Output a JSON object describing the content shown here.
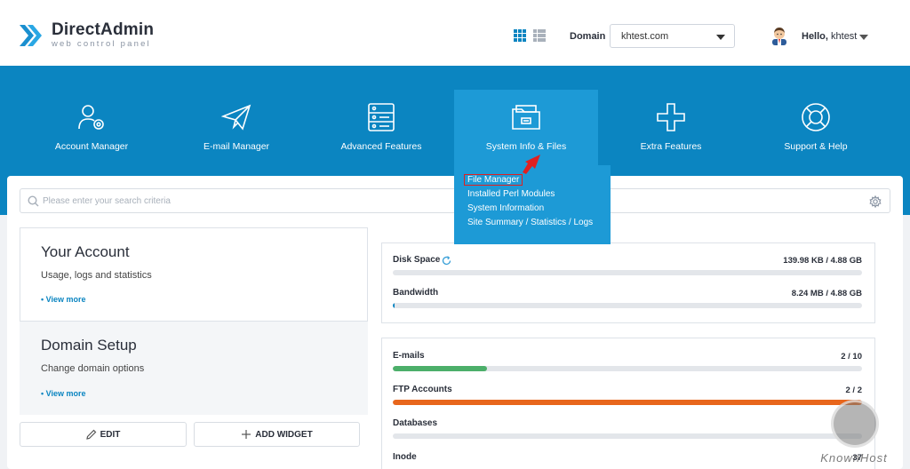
{
  "header": {
    "brand": "DirectAdmin",
    "tagline": "web control panel",
    "domain_label": "Domain",
    "domain_value": "khtest.com",
    "greeting_prefix": "Hello,",
    "username": "khtest"
  },
  "nav": [
    {
      "label": "Account Manager",
      "icon": "account-icon"
    },
    {
      "label": "E-mail Manager",
      "icon": "paper-plane-icon"
    },
    {
      "label": "Advanced Features",
      "icon": "server-icon"
    },
    {
      "label": "System Info & Files",
      "icon": "folder-icon"
    },
    {
      "label": "Extra Features",
      "icon": "plus-icon"
    },
    {
      "label": "Support & Help",
      "icon": "lifebuoy-icon"
    }
  ],
  "dropdown": [
    "File Manager",
    "Installed Perl Modules",
    "System Information",
    "Site Summary / Statistics / Logs"
  ],
  "search": {
    "placeholder": "Please enter your search criteria"
  },
  "account": {
    "title": "Your Account",
    "subtitle": "Usage, logs and statistics",
    "more": "• View more"
  },
  "domain_setup": {
    "title": "Domain Setup",
    "subtitle": "Change domain options",
    "more": "• View more"
  },
  "buttons": {
    "edit": "EDIT",
    "add_widget": "ADD WIDGET"
  },
  "stats": [
    {
      "label": "Disk Space",
      "value": "139.98 KB / 4.88 GB",
      "fraction": 0.0,
      "color": "#0b85c1"
    },
    {
      "label": "Bandwidth",
      "value": "8.24 MB / 4.88 GB",
      "fraction": 0.002,
      "color": "#0b85c1"
    },
    {
      "label": "E-mails",
      "value": "2 / 10",
      "fraction": 0.2,
      "color": "#4caf6a"
    },
    {
      "label": "FTP Accounts",
      "value": "2 / 2",
      "fraction": 1.0,
      "color": "#e8661c"
    },
    {
      "label": "Databases",
      "value": "",
      "fraction": 0.0,
      "color": "#0b85c1"
    },
    {
      "label": "Inode",
      "value": "37",
      "fraction": 0.0,
      "color": "#0b85c1"
    }
  ],
  "watermark": "KnownHost",
  "colors": {
    "primary": "#0b85c1",
    "active_nav": "#1d9ad6",
    "highlight": "#e02020"
  }
}
